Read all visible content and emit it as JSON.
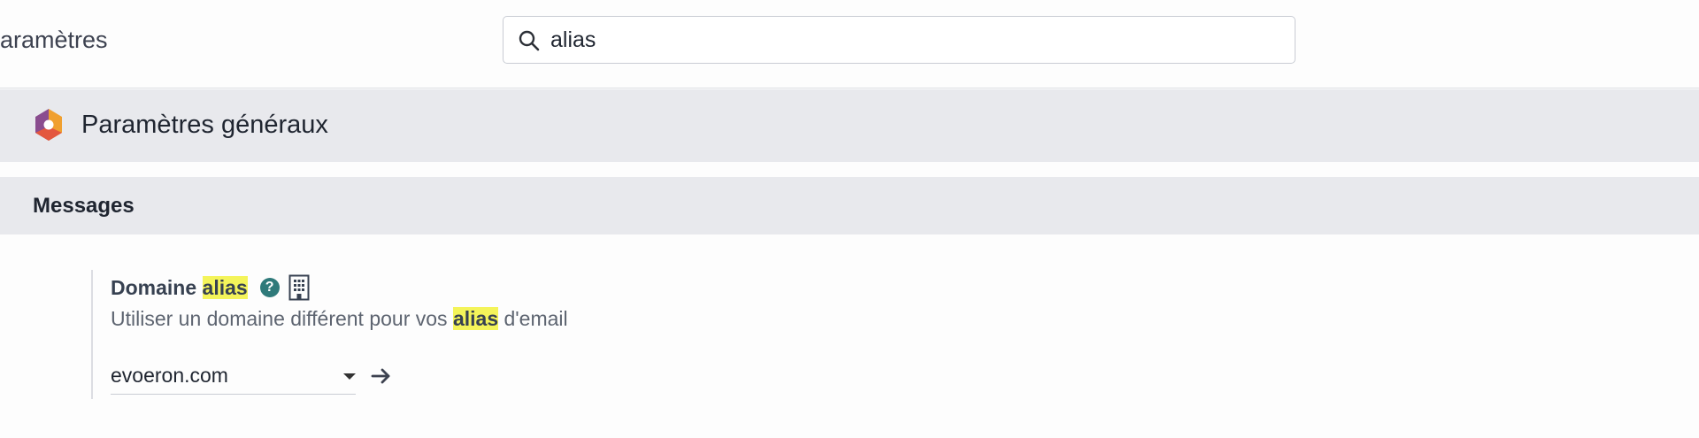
{
  "header": {
    "page_title": "Paramètres",
    "search": {
      "value": "alias",
      "placeholder": ""
    }
  },
  "app": {
    "title": "Paramètres généraux"
  },
  "section": {
    "title": "Messages"
  },
  "setting": {
    "title_prefix": "Domaine ",
    "title_highlight": "alias",
    "help_glyph": "?",
    "description_prefix": "Utiliser un domaine différent pour vos ",
    "description_highlight": "alias",
    "description_suffix": " d'email",
    "domain_value": "evoeron.com"
  },
  "icons": {
    "search": "search-icon",
    "logo": "settings-app-logo",
    "help": "help-icon",
    "company": "building-icon",
    "dropdown": "caret-down-icon",
    "link": "arrow-right-icon"
  },
  "colors": {
    "highlight": "#f4f45a",
    "panel_bg": "#e8e9ed",
    "help_icon": "#2f7a7a"
  }
}
